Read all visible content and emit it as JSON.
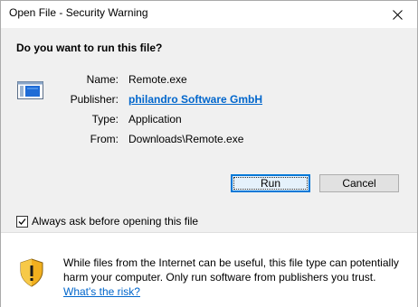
{
  "window": {
    "title": "Open File - Security Warning"
  },
  "dialog": {
    "question": "Do you want to run this file?",
    "properties": [
      {
        "label": "Name:",
        "value": "Remote.exe"
      },
      {
        "label": "Publisher:",
        "value": "philandro Software GmbH"
      },
      {
        "label": "Type:",
        "value": "Application"
      },
      {
        "label": "From:",
        "value": "Downloads\\Remote.exe"
      }
    ],
    "buttons": {
      "run": "Run",
      "cancel": "Cancel"
    },
    "always_ask": {
      "label": "Always ask before opening this file",
      "checked": true
    },
    "warning": {
      "line1": "While files from the Internet can be useful, this file type can potentially",
      "line2": "harm your computer. Only run software from publishers you trust.",
      "link": "What's the risk?"
    }
  },
  "colors": {
    "link": "#0066cc",
    "focus_border": "#0078d7",
    "client_bg": "#f0f0f0"
  },
  "icons": [
    "close-icon",
    "application-file-icon",
    "checkmark-icon",
    "security-shield-icon"
  ]
}
